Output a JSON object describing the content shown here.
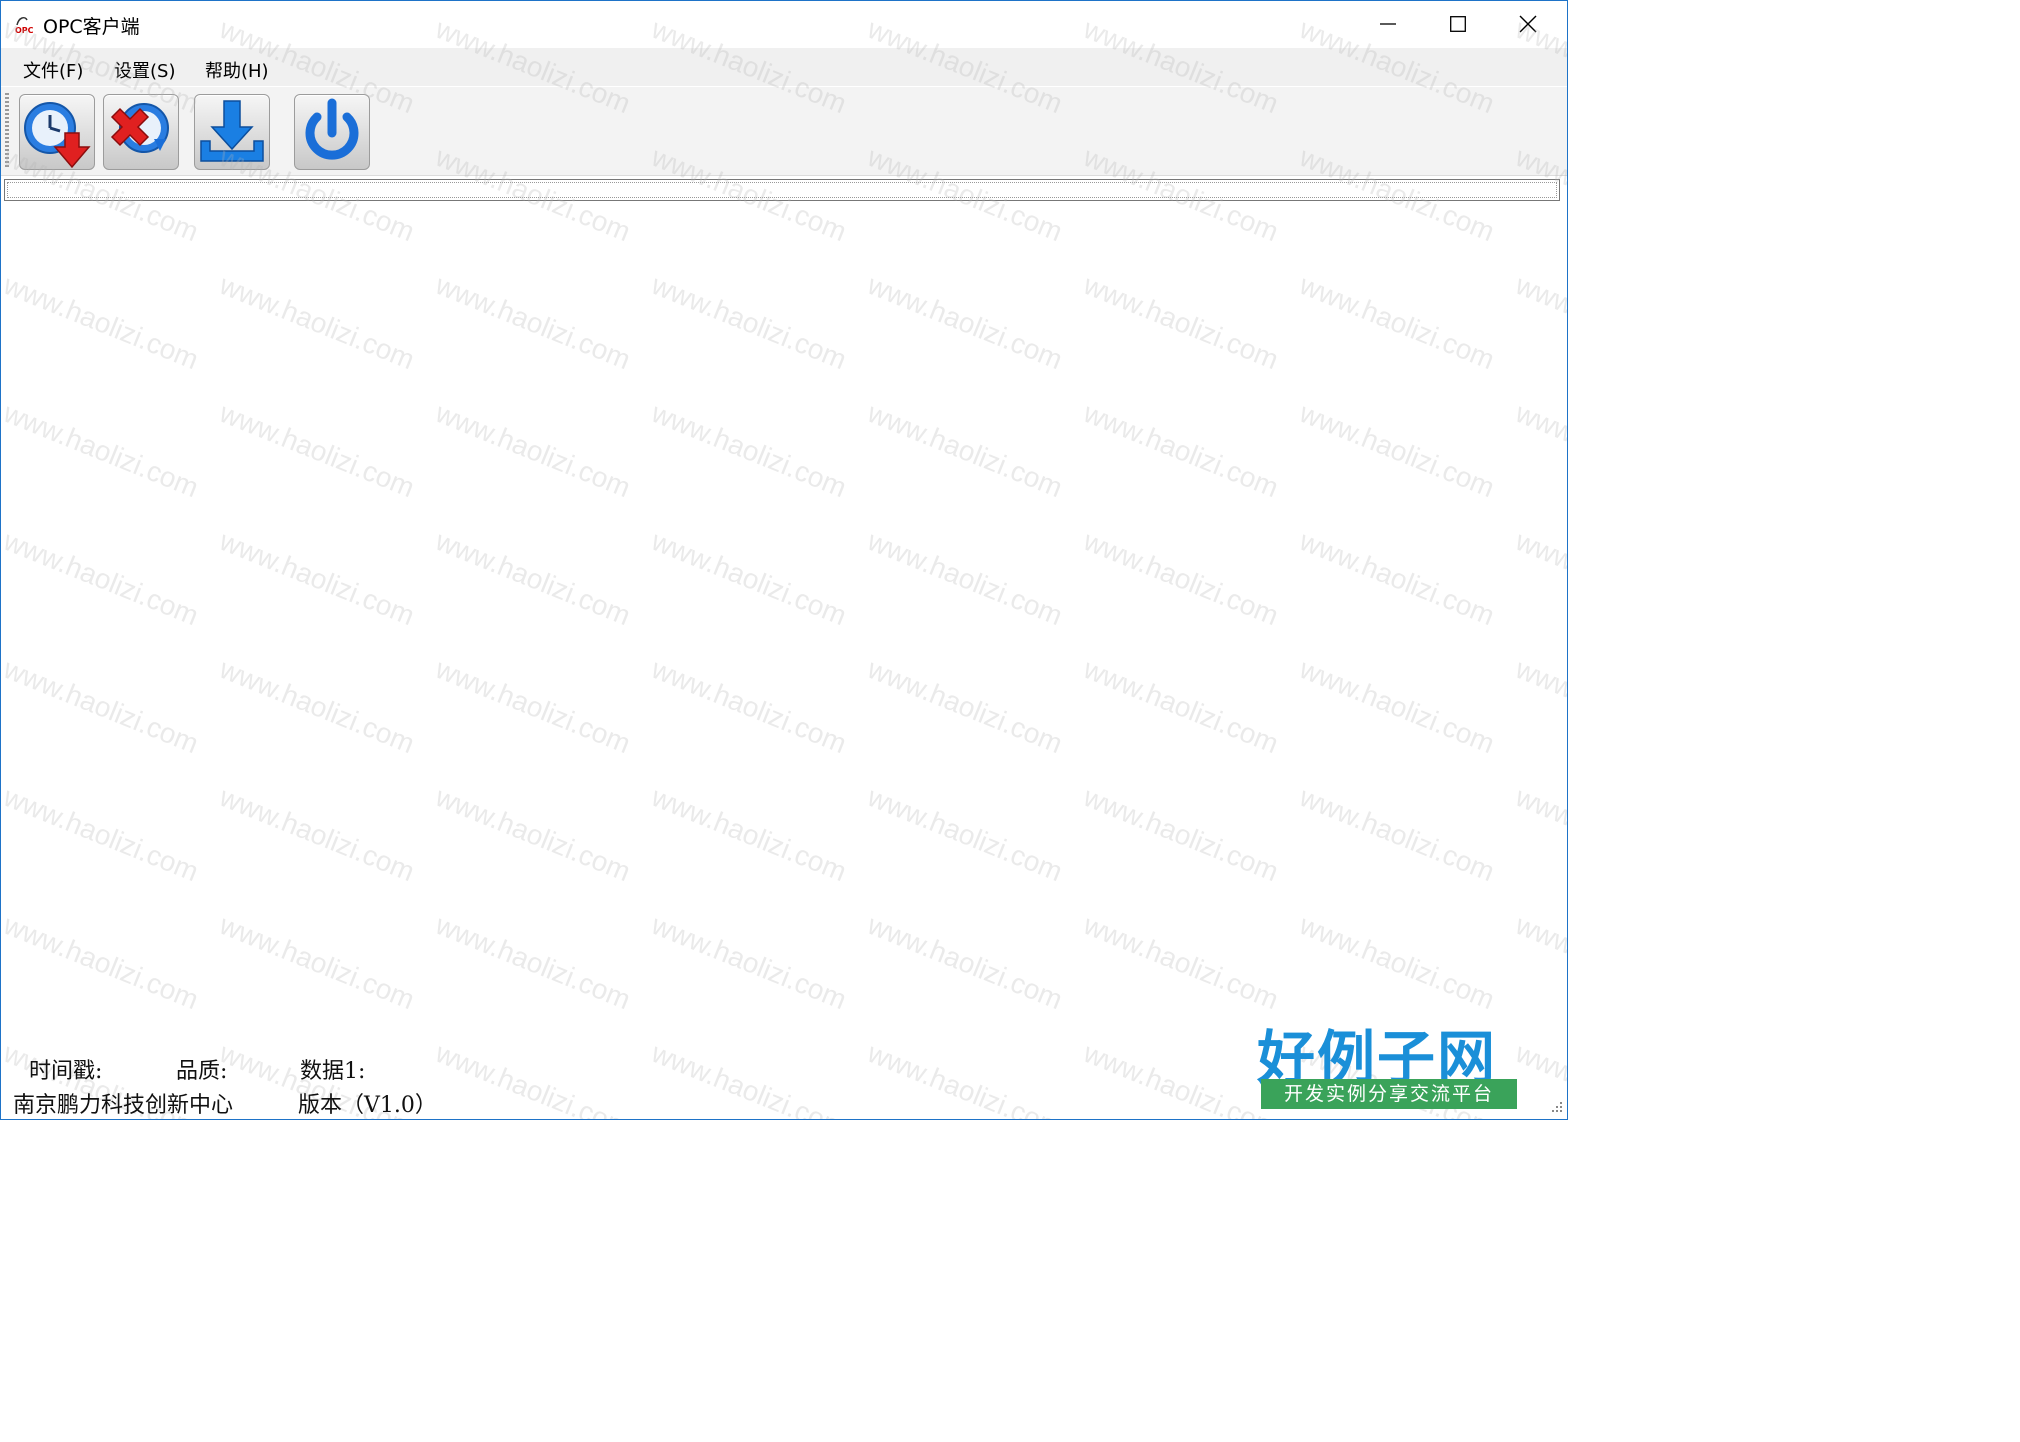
{
  "window": {
    "title": "OPC客户端"
  },
  "menu": {
    "file": "文件(F)",
    "settings": "设置(S)",
    "help": "帮助(H)"
  },
  "toolbar": {
    "buttons": [
      {
        "icon": "clock-download-icon"
      },
      {
        "icon": "clock-cancel-icon"
      },
      {
        "icon": "download-icon"
      },
      {
        "icon": "power-icon"
      }
    ]
  },
  "status": {
    "timestamp_label": "时间戳:",
    "quality_label": "品质:",
    "data1_label": "数据1:",
    "organization": "南京鹏力科技创新中心",
    "version": "版本（V1.0）"
  },
  "watermark": {
    "text": "www.haolizi.com"
  },
  "logo": {
    "title": "好例子网",
    "subtitle": "开发实例分享交流平台"
  },
  "colors": {
    "accent": "#1e73c8",
    "logo_blue": "#1a8fd8",
    "logo_green": "#3aa35a",
    "icon_red": "#e02020",
    "icon_blue": "#1a6ed8"
  }
}
